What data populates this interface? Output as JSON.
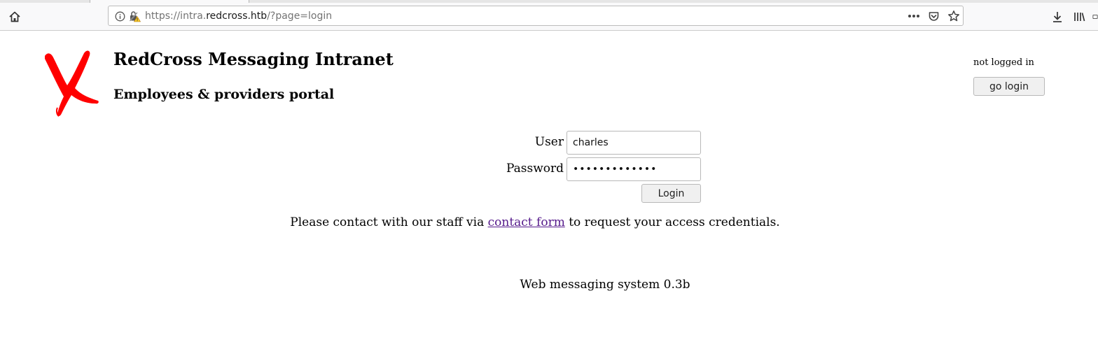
{
  "browser": {
    "url_prefix": "https://intra.",
    "url_domain": "redcross.htb",
    "url_path": "/?page=login",
    "icons": {
      "home": "home-icon",
      "info": "info-icon",
      "insecure_lock": "insecure-lock-icon",
      "more": "more-actions-icon",
      "pocket": "pocket-icon",
      "bookmark": "bookmark-star-icon",
      "downloads": "download-icon",
      "library": "library-icon",
      "sidebar": "sidebar-icon"
    }
  },
  "header": {
    "title": "RedCross Messaging Intranet",
    "subtitle": "Employees & providers portal",
    "logo_color": "#ff0000"
  },
  "session": {
    "status": "not logged in",
    "go_login_label": "go login"
  },
  "login_form": {
    "user_label": "User",
    "user_value": "charles",
    "password_label": "Password",
    "password_value": "•••••••••••••",
    "submit_label": "Login"
  },
  "contact": {
    "before": "Please contact with our staff via ",
    "link_text": "contact form",
    "after": " to request your access credentials.",
    "link_color": "#551a8b"
  },
  "footer": {
    "text": "Web messaging system 0.3b"
  }
}
